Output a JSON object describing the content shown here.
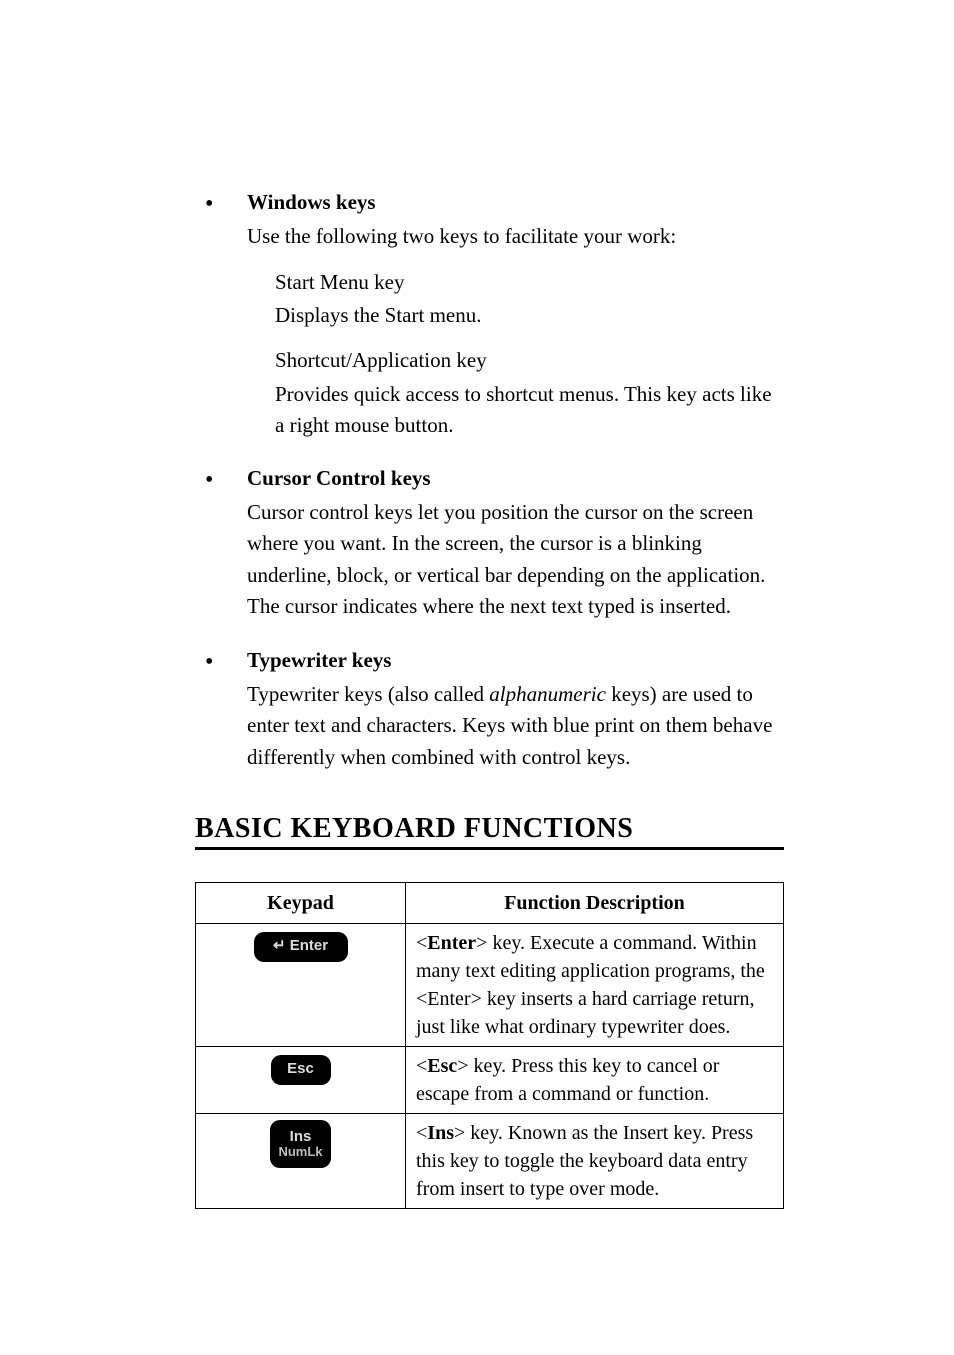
{
  "bullets": {
    "windows": {
      "title": "Windows keys",
      "intro": "Use the following two keys to facilitate your work:",
      "item1_title": "Start Menu key",
      "item1_body": "Displays the Start menu.",
      "item2_title": "Shortcut/Application key",
      "item2_body": "Provides quick access to shortcut menus. This key acts like a right mouse button."
    },
    "cursor": {
      "title": "Cursor Control keys",
      "body": "Cursor control keys let you position the cursor on the screen where you want. In the screen, the cursor is a blinking underline, block, or vertical bar depending on the application. The cursor indicates where the next text typed is inserted."
    },
    "typewriter": {
      "title": "Typewriter keys",
      "pre": "Typewriter keys (also called ",
      "ital": "alphanumeric",
      "post": " keys) are used to enter text and characters. Keys with blue print on them behave differently when combined with control keys."
    }
  },
  "section_title": "BASIC KEYBOARD FUNCTIONS",
  "table": {
    "head_keypad": "Keypad",
    "head_func": "Function Description",
    "rows": [
      {
        "key_line1": "↵ Enter",
        "key_line2": "",
        "key_style": "wide",
        "desc_bold": "Enter",
        "desc_rest": "> key. Execute a command. Within many text editing application programs, the <Enter> key inserts a hard carriage return, just like what ordinary typewriter does."
      },
      {
        "key_line1": "Esc",
        "key_line2": "",
        "key_style": "wide2",
        "desc_bold": "Esc",
        "desc_rest": "> key. Press this key to cancel or escape from a command or function."
      },
      {
        "key_line1": "Ins",
        "key_line2": "NumLk",
        "key_style": "tall",
        "desc_bold": "Ins",
        "desc_rest": "> key. Known as the Insert key. Press this key to toggle the keyboard data entry from insert to type over mode."
      }
    ]
  }
}
